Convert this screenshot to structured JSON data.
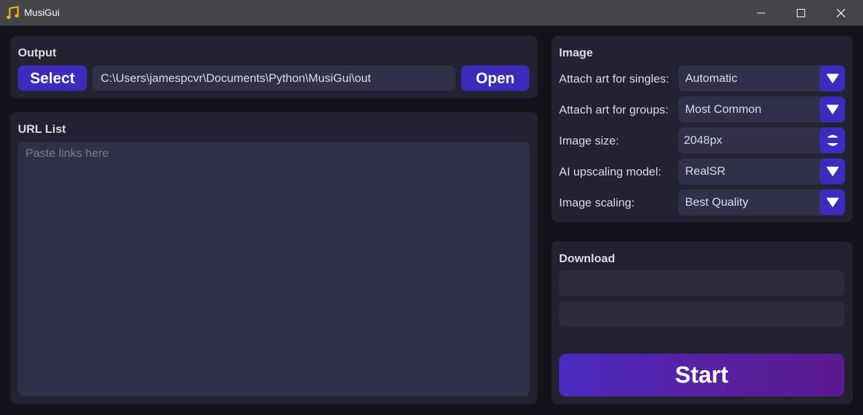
{
  "window": {
    "title": "MusiGui"
  },
  "output": {
    "title": "Output",
    "select_label": "Select",
    "path": "C:\\Users\\jamespcvr\\Documents\\Python\\MusiGui\\out",
    "open_label": "Open"
  },
  "url_list": {
    "title": "URL List",
    "placeholder": "Paste links here",
    "value": ""
  },
  "image": {
    "title": "Image",
    "rows": [
      {
        "label": "Attach art for singles:",
        "value": "Automatic",
        "control": "dropdown"
      },
      {
        "label": "Attach art for groups:",
        "value": "Most Common",
        "control": "dropdown"
      },
      {
        "label": "Image size:",
        "value": "2048px",
        "control": "spinner"
      },
      {
        "label": "AI upscaling model:",
        "value": "RealSR",
        "control": "dropdown"
      },
      {
        "label": "Image scaling:",
        "value": "Best Quality",
        "control": "dropdown"
      }
    ]
  },
  "download": {
    "title": "Download",
    "progress": [
      0,
      0
    ],
    "start_label": "Start"
  },
  "colors": {
    "accent": "#3d2cbc",
    "background": "#13131c",
    "panel": "#232232",
    "field": "#303048",
    "app_icon": "#f5b400"
  },
  "icons": {
    "app": "music-note-icon",
    "minimize": "minimize-icon",
    "maximize": "maximize-icon",
    "close": "close-icon",
    "dropdown": "triangle-down-icon",
    "spinner": "spinner-arrows-icon"
  }
}
